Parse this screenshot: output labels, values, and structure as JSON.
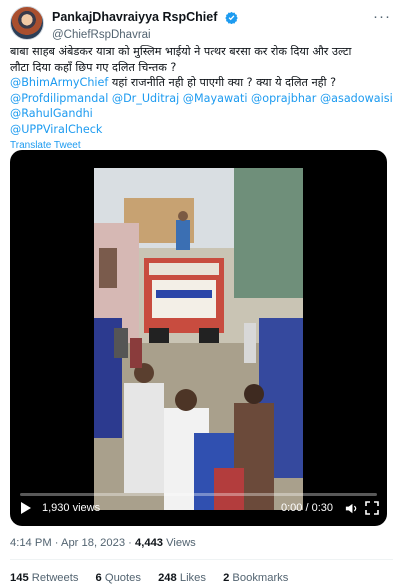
{
  "author": {
    "display_name": "PankajDhavraiyya RspChief",
    "handle": "@ChiefRspDhavrai",
    "verified_icon": "verified-badge-icon",
    "more_icon": "more-options-icon"
  },
  "tweet": {
    "line1": "बाबा साहब अंबेडकर यात्रा को मुस्लिम भाईयो ने पत्थर बरसा कर रोक दिया और उल्टा",
    "line2": "लौटा दिया कहाँ छिप गए दलित चिन्तक ?",
    "line3_mention": "@BhimArmyChief",
    "line3_text": " यहां राजनीति नही हो पाएगी क्या ?  क्या ये दलित नही ?",
    "mentions_row": [
      "@Profdilipmandal",
      "@Dr_Uditraj",
      "@Mayawati",
      "@oprajbhar",
      "@asadowaisi"
    ],
    "mention_rahul": "@RahulGandhi",
    "mention_upp": "@UPPViralCheck",
    "translate_label": "Translate Tweet"
  },
  "video": {
    "views": "1,930 views",
    "time": "0:00 / 0:30",
    "progress": 0,
    "play_icon": "play-icon",
    "volume_icon": "volume-icon",
    "fullscreen_icon": "fullscreen-icon"
  },
  "meta": {
    "time": "4:14 PM",
    "sep1": " · ",
    "date": "Apr 18, 2023",
    "sep2": " · ",
    "view_count": "4,443",
    "view_label": " Views"
  },
  "stats": {
    "retweets_count": "145",
    "retweets_label": " Retweets",
    "quotes_count": "6",
    "quotes_label": " Quotes",
    "likes_count": "248",
    "likes_label": " Likes",
    "bookmarks_count": "2",
    "bookmarks_label": " Bookmarks"
  },
  "colors": {
    "accent": "#1d9bf0",
    "text": "#0f1419",
    "muted": "#536471"
  }
}
